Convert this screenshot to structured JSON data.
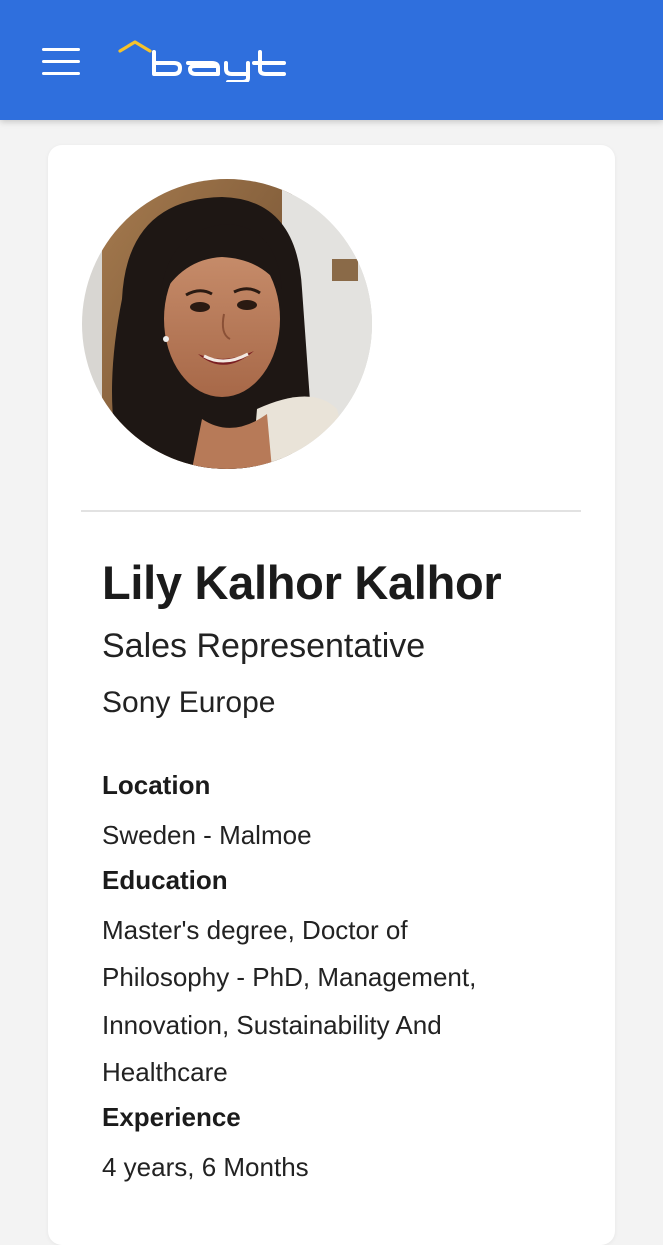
{
  "header": {
    "brand": "bayt",
    "colors": {
      "bar": "#2f6fdd",
      "icon": "#ffffff",
      "logo_roof": "#f5c22b"
    }
  },
  "profile": {
    "name": "Lily Kalhor Kalhor",
    "title": "Sales Representative",
    "company": "Sony Europe"
  },
  "details": {
    "location_label": "Location",
    "location_value": "Sweden - Malmoe",
    "education_label": "Education",
    "education_lines": [
      "Master's degree, Doctor of",
      "Philosophy - PhD, Management,",
      "Innovation, Sustainability And",
      "Healthcare"
    ],
    "experience_label": "Experience",
    "experience_value": "4 years, 6 Months"
  },
  "icons": {
    "menu": "hamburger-menu-icon",
    "logo": "bayt-logo",
    "avatar": "profile-photo"
  }
}
